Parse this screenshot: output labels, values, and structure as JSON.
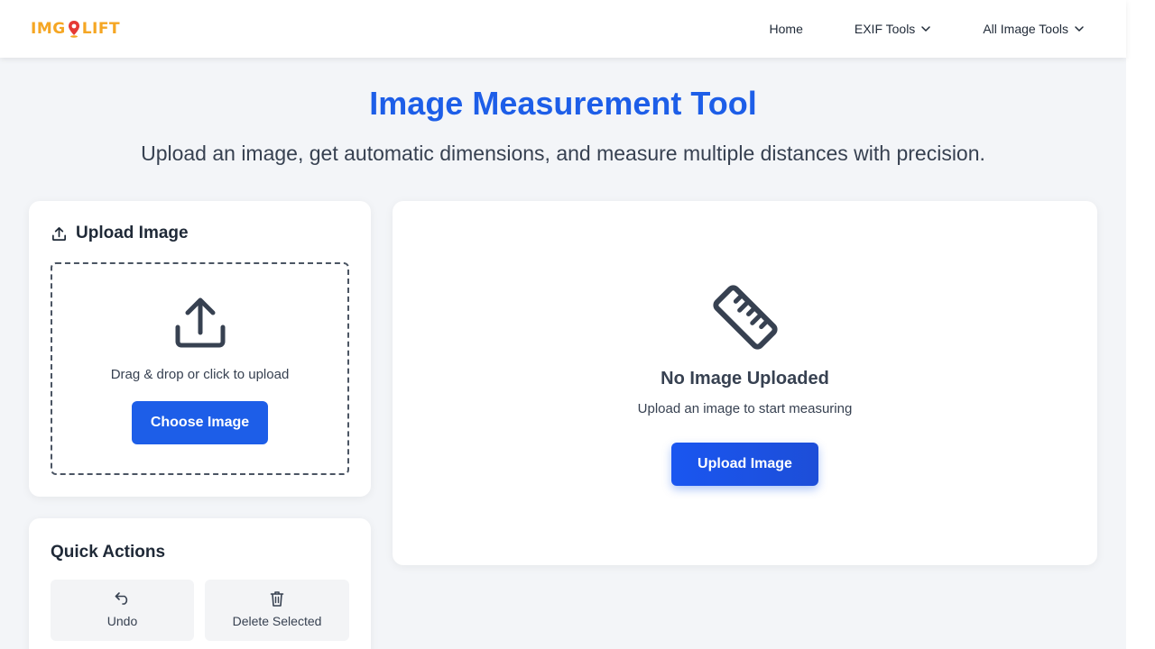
{
  "header": {
    "logo": {
      "left": "IMG",
      "right": "LIFT"
    },
    "nav": {
      "home": "Home",
      "exif_tools": "EXIF Tools",
      "all_image_tools": "All Image Tools"
    }
  },
  "hero": {
    "title": "Image Measurement Tool",
    "subtitle": "Upload an image, get automatic dimensions, and measure multiple distances with precision."
  },
  "upload_card": {
    "title": "Upload Image",
    "drop_text": "Drag & drop or click to upload",
    "choose_button": "Choose Image"
  },
  "quick_actions": {
    "title": "Quick Actions",
    "undo": "Undo",
    "delete_selected": "Delete Selected"
  },
  "preview": {
    "empty_title": "No Image Uploaded",
    "empty_subtitle": "Upload an image to start measuring",
    "upload_button": "Upload Image"
  },
  "colors": {
    "accent": "#1d5ee8",
    "logo": "#f5a623",
    "logo_pin": "#e53935",
    "background": "#f3f5f8"
  },
  "icons": {
    "upload_card_title": "upload-icon",
    "dropzone": "upload-tray-icon",
    "undo": "undo-icon",
    "delete": "trash-icon",
    "empty_state": "ruler-icon",
    "nav_dropdown": "chevron-down-icon",
    "logo_pin": "map-pin-icon"
  }
}
